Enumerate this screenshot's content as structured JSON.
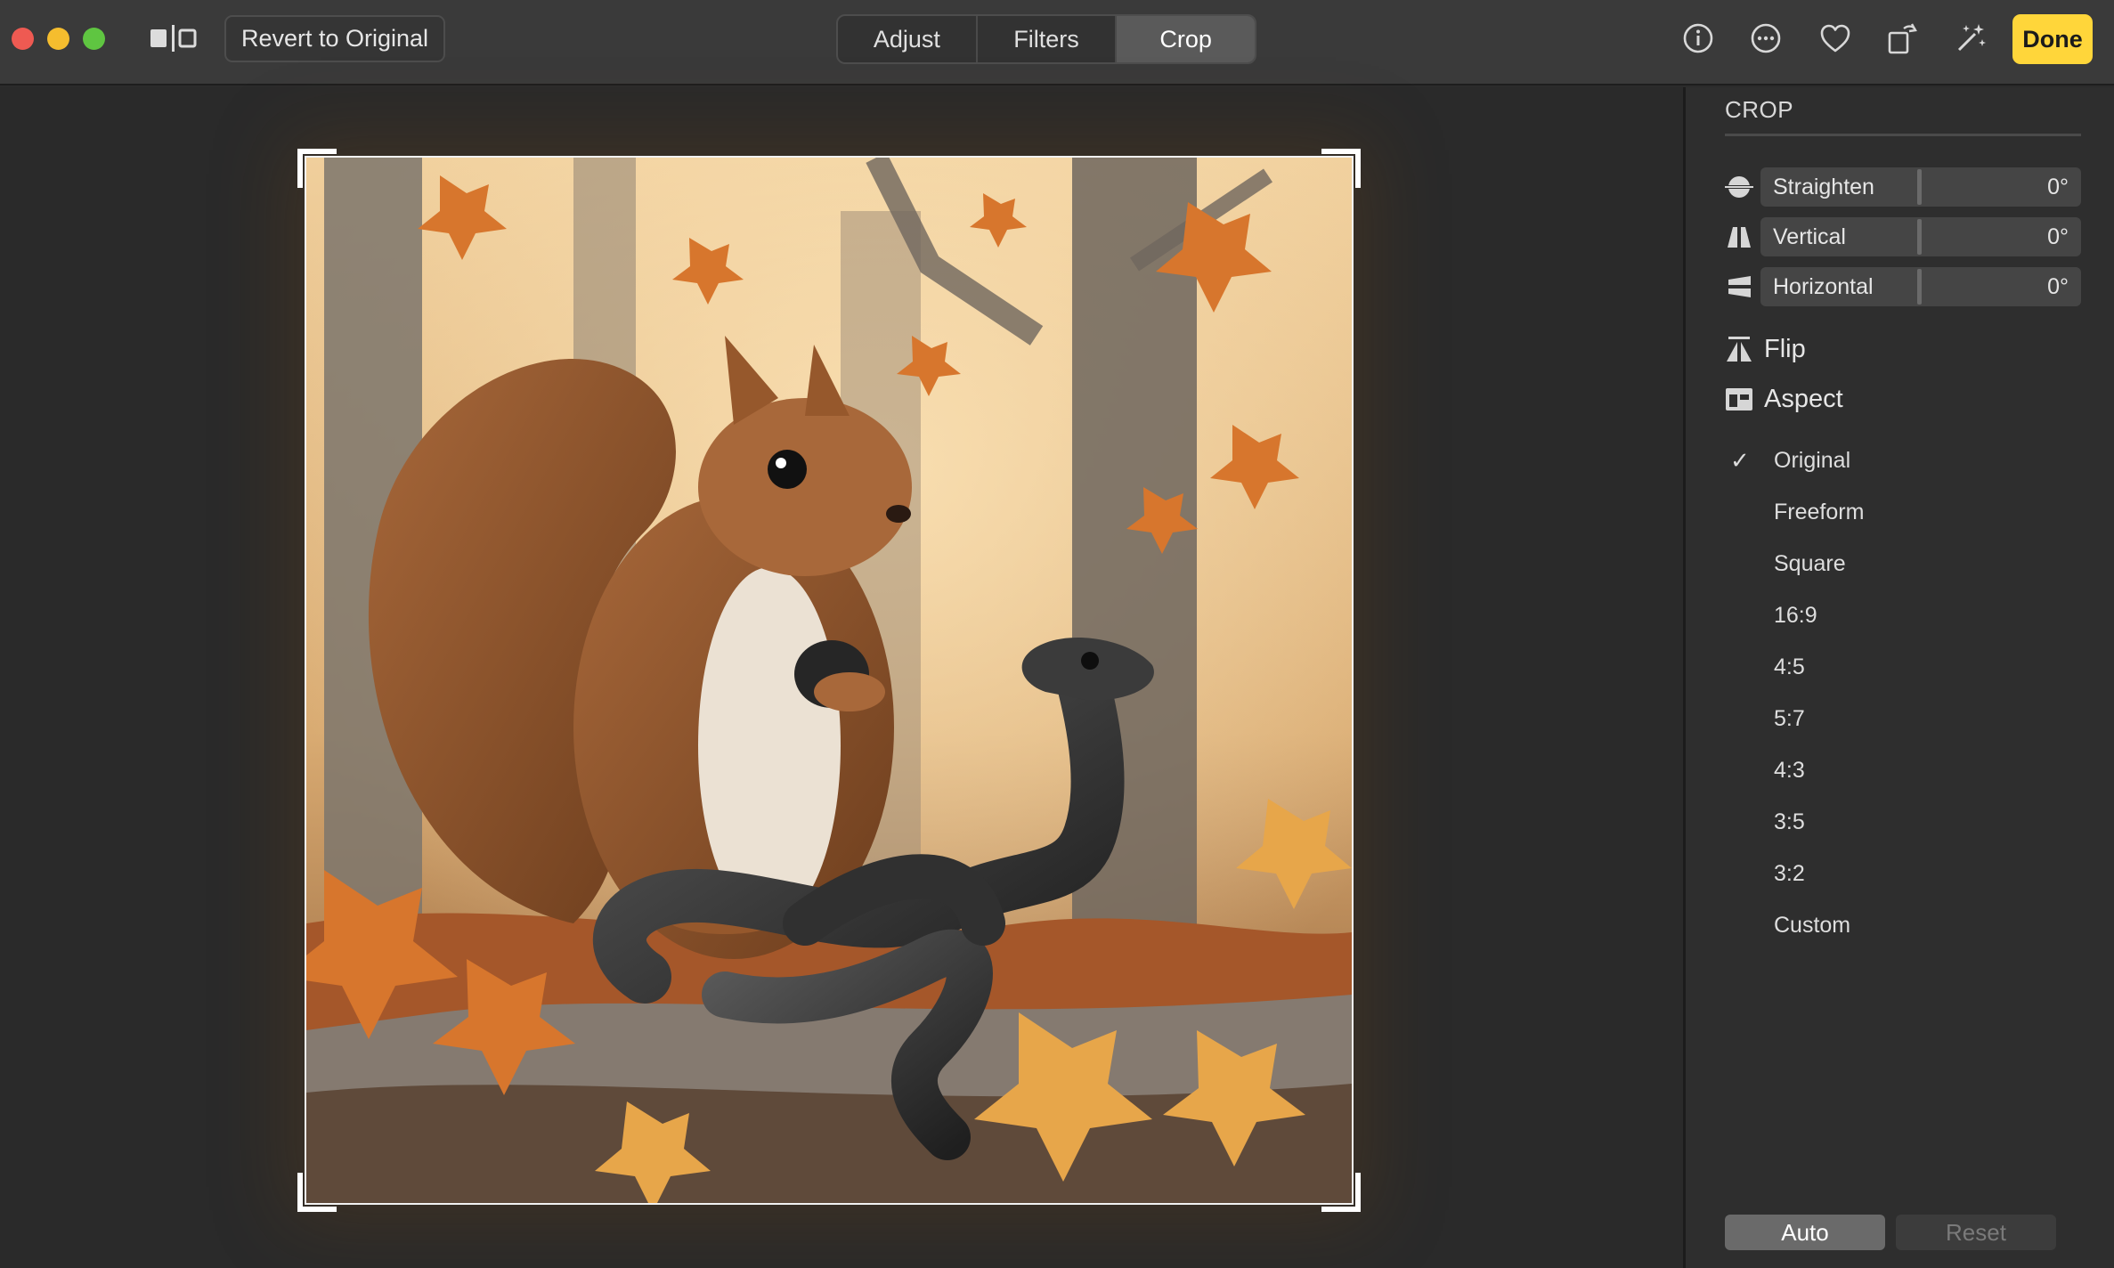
{
  "toolbar": {
    "revert_label": "Revert to Original",
    "tabs": [
      {
        "label": "Adjust",
        "active": false
      },
      {
        "label": "Filters",
        "active": false
      },
      {
        "label": "Crop",
        "active": true
      }
    ],
    "icons": [
      "info-icon",
      "more-icon",
      "heart-icon",
      "rotate-icon",
      "magic-wand-icon"
    ],
    "done_label": "Done",
    "accent_color": "#ffd63a"
  },
  "sidebar": {
    "title": "CROP",
    "sliders": [
      {
        "label": "Straighten",
        "value": "0°",
        "icon": "straighten-icon"
      },
      {
        "label": "Vertical",
        "value": "0°",
        "icon": "vertical-perspective-icon"
      },
      {
        "label": "Horizontal",
        "value": "0°",
        "icon": "horizontal-perspective-icon"
      }
    ],
    "flip_label": "Flip",
    "aspect_label": "Aspect",
    "aspect_options": [
      {
        "label": "Original",
        "selected": true
      },
      {
        "label": "Freeform",
        "selected": false
      },
      {
        "label": "Square",
        "selected": false
      },
      {
        "label": "16:9",
        "selected": false
      },
      {
        "label": "4:5",
        "selected": false
      },
      {
        "label": "5:7",
        "selected": false
      },
      {
        "label": "4:3",
        "selected": false
      },
      {
        "label": "3:5",
        "selected": false
      },
      {
        "label": "3:2",
        "selected": false
      },
      {
        "label": "Custom",
        "selected": false
      }
    ],
    "check_mark": "✓",
    "auto_label": "Auto",
    "reset_label": "Reset"
  }
}
